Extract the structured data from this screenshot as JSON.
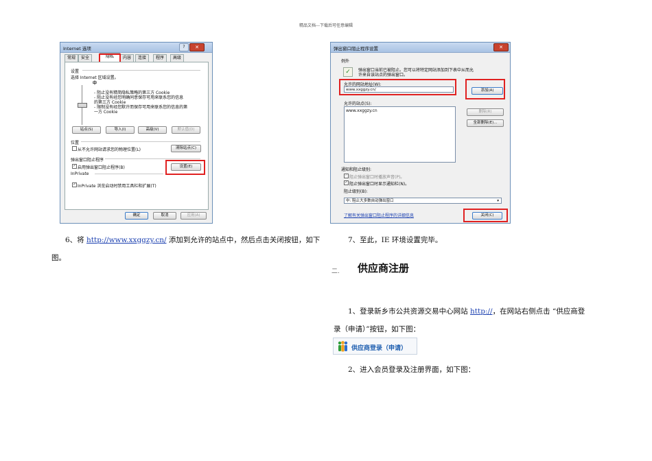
{
  "header": {
    "text": "精品文档---下载后可任意编辑"
  },
  "left_dialog": {
    "title": "Internet 选项",
    "tabs": [
      "常规",
      "安全",
      "隐私",
      "内容",
      "连接",
      "程序",
      "高级"
    ],
    "settings_label": "设置",
    "zone_text": "选择 Internet 区域设置。",
    "level": "中",
    "desc_lines": [
      "- 阻止没有精简隐私策略的第三方 Cookie",
      "- 阻止没有经您明确同意保存可用来联系您的信息",
      "的第三方 Cookie",
      "- 限制没有经您默许而保存可用来联系您的信息的第",
      "一方 Cookie"
    ],
    "buttons_row": [
      "站点(S)",
      "导入(I)",
      "高级(V)",
      "默认值(D)"
    ],
    "location_label": "位置",
    "location_cb": "从不允许网站请求您的物理位置(L)",
    "clear_sites_btn": "清除站点(C)",
    "popup_label": "弹出窗口阻止程序",
    "popup_cb": "启用弹出窗口阻止程序(B)",
    "settings_btn": "设置(E)",
    "inprivate_label": "InPrivate",
    "inprivate_cb": "InPrivate 浏览启动时禁用工具栏和扩展(T)",
    "footer_buttons": [
      "确定",
      "取消",
      "应用(A)"
    ]
  },
  "right_dialog": {
    "title": "弹出窗口阻止程序设置",
    "exceptions_label": "例外",
    "info_line1": "弹出窗口当前已被阻止。您可以将特定网站添加到下表中从而允",
    "info_line2": "许来自该站点的弹出窗口。",
    "address_label": "允许的网站地址(W):",
    "address_value": "www.xxggzy.cn/",
    "add_btn": "添加(A)",
    "allowed_label": "允许的站点(S):",
    "allowed_item": "www.xxggzy.cn",
    "delete_btn": "删除(R)",
    "delete_all_btn": "全部删除(E)...",
    "notify_label": "通知和阻止级别:",
    "notify_cb1": "阻止弹出窗口时播放声音(P)。",
    "notify_cb2": "阻止弹出窗口时显示通知栏(N)。",
    "block_level_label": "阻止级别(B):",
    "block_level_value": "中: 阻止大多数自动弹出窗口",
    "learn_link": "了解有关弹出窗口阻止程序的详细信息",
    "close_btn": "关闭(C)"
  },
  "left_col": {
    "step6_prefix": "6、将 ",
    "step6_link": "http://www.xxggzy.cn/",
    "step6_suffix": " 添加到允许的站点中，然后点击关闭按钮，如下",
    "step6_line2": "图。"
  },
  "right_col": {
    "step7": "7、至此，IE 环境设置完毕。",
    "section_num": "二.",
    "section_title": "供应商注册",
    "step1_prefix": "1、登录新乡市公共资源交易中心网站 ",
    "step1_link": "http://",
    "step1_suffix": "，在网站右侧点击 “供应商登",
    "step1_line2": "录（申请）”按钮，如下图：",
    "register_button": "供应商登录（申请）",
    "step2": "2、进入会员登录及注册界面，如下图："
  },
  "colors": {
    "highlight": "#e02020",
    "link": "#1a3fb0",
    "banner_blue": "#1f5fb0"
  }
}
